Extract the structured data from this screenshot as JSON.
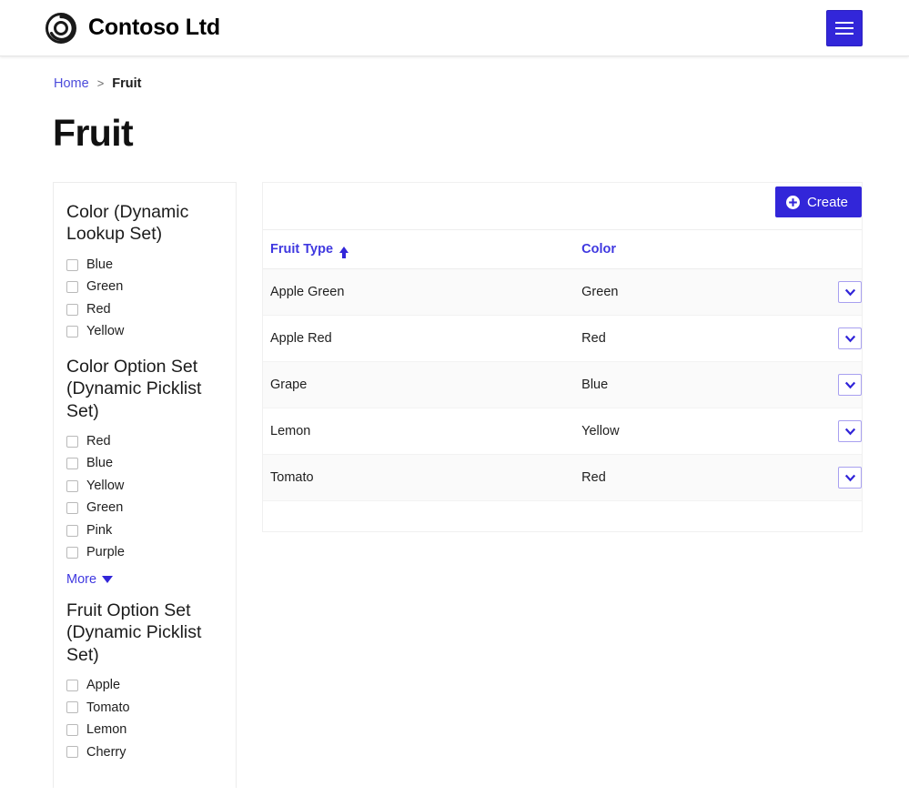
{
  "header": {
    "brand_name": "Contoso Ltd",
    "logo_icon": "contoso-spiral-logo",
    "nav_toggle_icon": "hamburger-menu-icon"
  },
  "breadcrumb": {
    "home_label": "Home",
    "separator": ">",
    "current_label": "Fruit"
  },
  "page": {
    "title": "Fruit"
  },
  "facets": [
    {
      "title": "Color (Dynamic Lookup Set)",
      "options": [
        {
          "label": "Blue",
          "checked": false
        },
        {
          "label": "Green",
          "checked": false
        },
        {
          "label": "Red",
          "checked": false
        },
        {
          "label": "Yellow",
          "checked": false
        }
      ],
      "more_label": null
    },
    {
      "title": "Color Option Set (Dynamic Picklist Set)",
      "options": [
        {
          "label": "Red",
          "checked": false
        },
        {
          "label": "Blue",
          "checked": false
        },
        {
          "label": "Yellow",
          "checked": false
        },
        {
          "label": "Green",
          "checked": false
        },
        {
          "label": "Pink",
          "checked": false
        },
        {
          "label": "Purple",
          "checked": false
        }
      ],
      "more_label": "More"
    },
    {
      "title": "Fruit Option Set (Dynamic Picklist Set)",
      "options": [
        {
          "label": "Apple",
          "checked": false
        },
        {
          "label": "Tomato",
          "checked": false
        },
        {
          "label": "Lemon",
          "checked": false
        },
        {
          "label": "Cherry",
          "checked": false
        }
      ],
      "more_label": null
    }
  ],
  "toolbar": {
    "create_label": "Create",
    "create_icon": "plus-circle-icon"
  },
  "grid": {
    "columns": [
      {
        "label": "Fruit Type",
        "sorted": "asc",
        "sort_icon": "sort-ascending-icon"
      },
      {
        "label": "Color",
        "sorted": null
      },
      {
        "label": ""
      }
    ],
    "rows": [
      {
        "fruit_type": "Apple Green",
        "color": "Green",
        "menu_icon": "chevron-down-icon"
      },
      {
        "fruit_type": "Apple Red",
        "color": "Red",
        "menu_icon": "chevron-down-icon"
      },
      {
        "fruit_type": "Grape",
        "color": "Blue",
        "menu_icon": "chevron-down-icon"
      },
      {
        "fruit_type": "Lemon",
        "color": "Yellow",
        "menu_icon": "chevron-down-icon"
      },
      {
        "fruit_type": "Tomato",
        "color": "Red",
        "menu_icon": "chevron-down-icon"
      }
    ]
  },
  "colors": {
    "accent": "#3226d9",
    "link": "#4b4bdb",
    "header_text": "#3f38e0",
    "row_stripe": "#fafafa"
  }
}
